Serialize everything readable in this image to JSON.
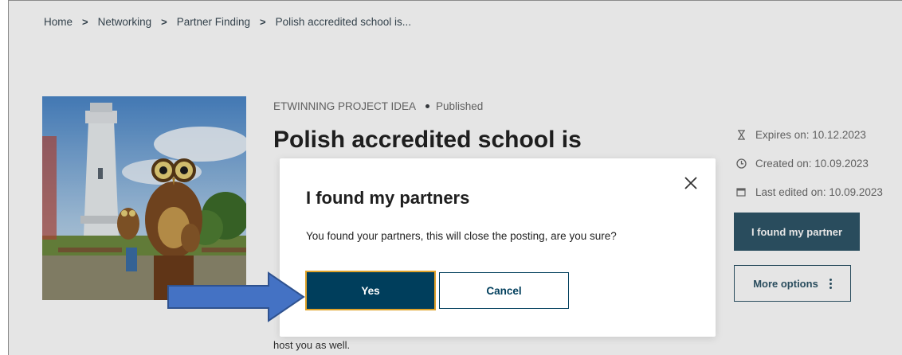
{
  "breadcrumb": {
    "items": [
      "Home",
      "Networking",
      "Partner Finding",
      "Polish accredited school is..."
    ],
    "separator": ">"
  },
  "hero_image": {
    "subject": "owl-statue-and-tower-photo"
  },
  "project": {
    "type_label": "ETWINNING PROJECT IDEA",
    "status": "Published",
    "title": "Polish accredited school is",
    "body_excerpt": "host you as well."
  },
  "info": {
    "expires": "Expires on: 10.12.2023",
    "created": "Created on: 10.09.2023",
    "edited": "Last edited on: 10.09.2023"
  },
  "actions": {
    "found_partner_label": "I found my partner",
    "more_options_label": "More options"
  },
  "modal": {
    "title": "I found my partners",
    "message": "You found your partners, this will close the posting, are you sure?",
    "yes_label": "Yes",
    "cancel_label": "Cancel"
  },
  "colors": {
    "primary": "#2e5568",
    "modal_primary": "#003e5c",
    "focus_ring": "#e0a32b",
    "annotation_arrow": "#4472c4"
  }
}
